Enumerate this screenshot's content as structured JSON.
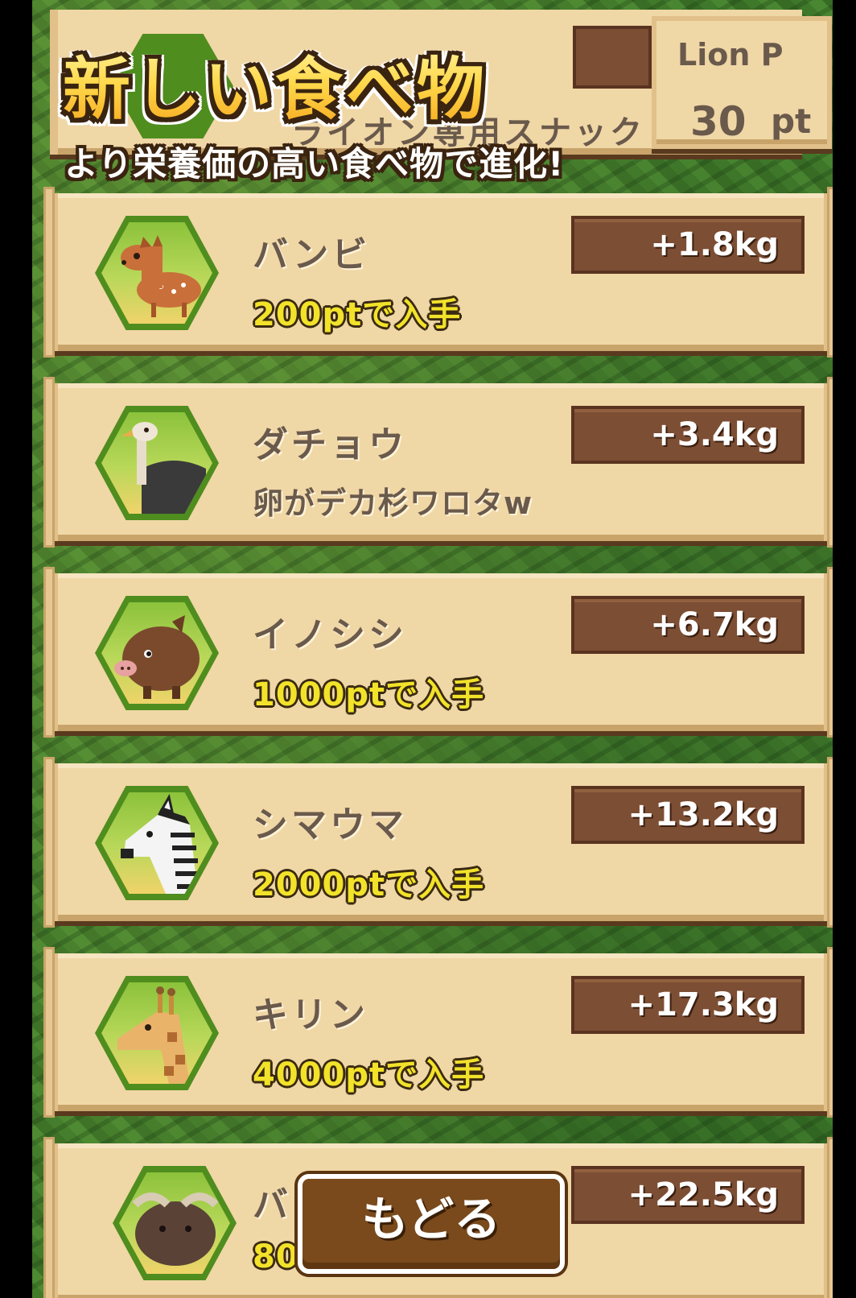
{
  "header": {
    "title": "新しい食べ物",
    "subtitle": "より栄養価の高い食べ物で進化!",
    "behind_text": "ライオン専用スナック菓",
    "points_label": "Lion P",
    "points_value": "30",
    "points_unit": "pt"
  },
  "foods": [
    {
      "name": "バンビ",
      "sub": "200ptで入手",
      "weight": "+1.8kg",
      "icon": "deer-icon"
    },
    {
      "name": "ダチョウ",
      "sub": "卵がデカ杉ワロタw",
      "weight": "+3.4kg",
      "icon": "ostrich-icon"
    },
    {
      "name": "イノシシ",
      "sub": "1000ptで入手",
      "weight": "+6.7kg",
      "icon": "boar-icon"
    },
    {
      "name": "シマウマ",
      "sub": "2000ptで入手",
      "weight": "+13.2kg",
      "icon": "zebra-icon"
    },
    {
      "name": "キリン",
      "sub": "4000ptで入手",
      "weight": "+17.3kg",
      "icon": "giraffe-icon"
    },
    {
      "name": "バ",
      "sub": "80",
      "weight": "+22.5kg",
      "icon": "buffalo-icon"
    }
  ],
  "back_button": "もどる"
}
